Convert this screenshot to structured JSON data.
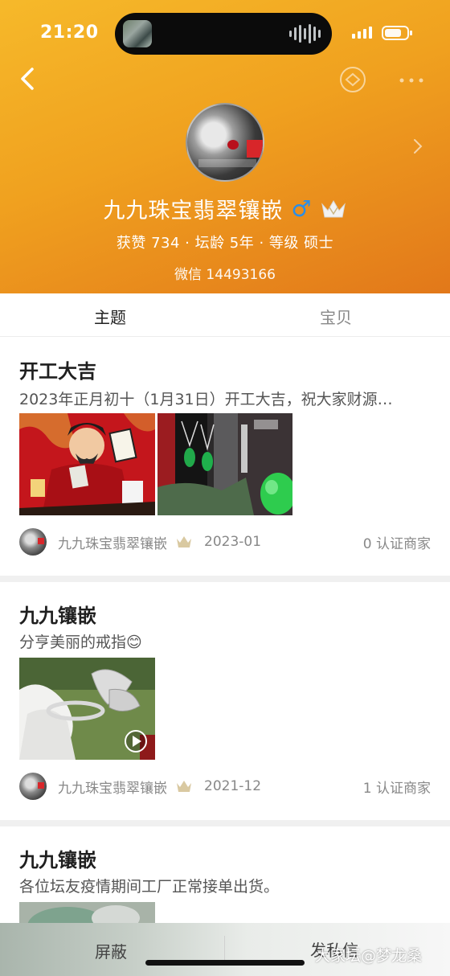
{
  "status_bar": {
    "time": "21:20"
  },
  "profile": {
    "name": "九九珠宝翡翠镶嵌",
    "gender_symbol": "♂",
    "stats": "获赞 734 · 坛龄 5年 · 等级 硕士",
    "wechat": "微信 14493166",
    "gender_color": "#2b8ee8"
  },
  "tabs": [
    {
      "label": "主题",
      "active": true
    },
    {
      "label": "宝贝",
      "active": false
    }
  ],
  "posts": [
    {
      "title": "开工大吉",
      "desc": "2023年正月初十（1月31日）开工大吉，祝大家财源…",
      "author": "九九珠宝翡翠镶嵌",
      "date": "2023-01",
      "count_label": "0  认证商家"
    },
    {
      "title": "九九镶嵌",
      "desc": "分亨美丽的戒指😊",
      "author": "九九珠宝翡翠镶嵌",
      "date": "2021-12",
      "count_label": "1  认证商家"
    },
    {
      "title": "九九镶嵌",
      "desc": "各位坛友疫情期间工厂正常接单出货。"
    }
  ],
  "bottom_bar": {
    "block_label": "屏蔽",
    "message_label": "发私信"
  },
  "watermark": "大家坛@梦龙桑",
  "colors": {
    "header_start": "#f6b92a",
    "header_end": "#e2781a",
    "accent_red": "#d8262a"
  }
}
